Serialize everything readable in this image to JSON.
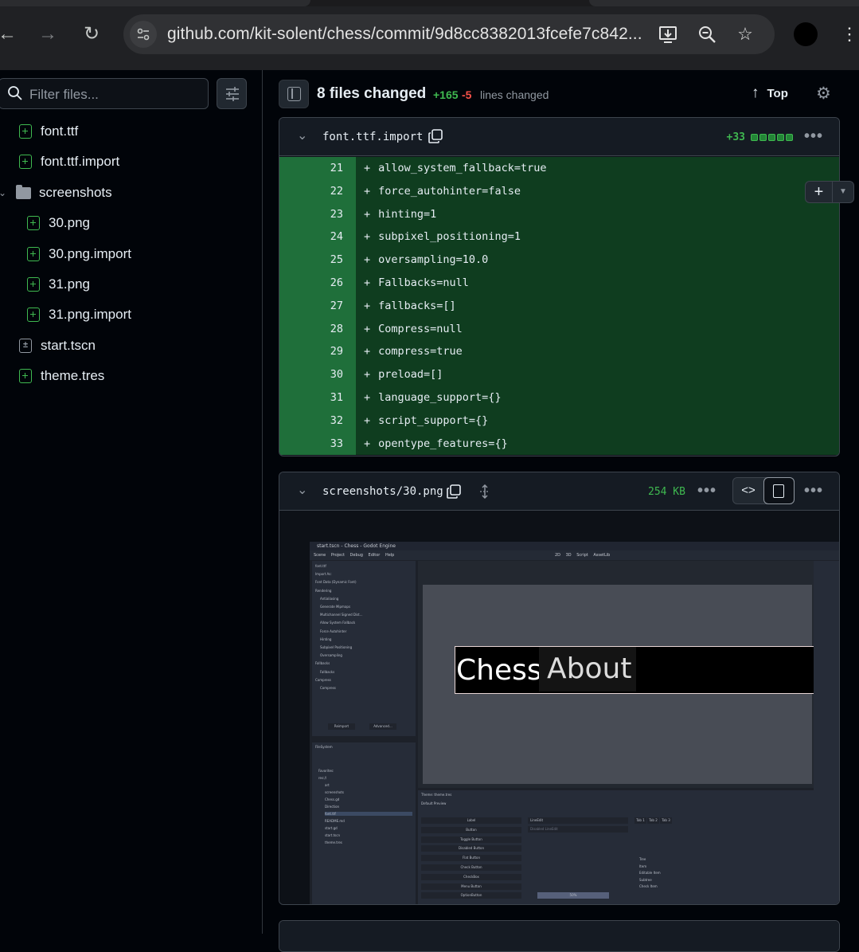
{
  "browser": {
    "url": "github.com/kit-solent/chess/commit/9d8cc8382013fcefe7c842...",
    "icons": [
      "back-arrow-icon",
      "forward-arrow-icon",
      "reload-icon",
      "site-info-icon",
      "install-app-icon",
      "zoom-icon",
      "bookmark-star-icon",
      "profile-avatar",
      "kebab-menu-icon"
    ]
  },
  "sidebar": {
    "filter_placeholder": "Filter files...",
    "files": [
      {
        "name": "font.ttf",
        "status": "added"
      },
      {
        "name": "font.ttf.import",
        "status": "added"
      },
      {
        "name": "screenshots",
        "type": "folder"
      },
      {
        "name": "30.png",
        "status": "added"
      },
      {
        "name": "30.png.import",
        "status": "added"
      },
      {
        "name": "31.png",
        "status": "added"
      },
      {
        "name": "31.png.import",
        "status": "added"
      },
      {
        "name": "start.tscn",
        "status": "modified"
      },
      {
        "name": "theme.tres",
        "status": "added"
      }
    ]
  },
  "header": {
    "files_changed": "8 files changed",
    "additions": "+165",
    "deletions": "-5",
    "lines_changed": "lines changed",
    "top_label": "Top"
  },
  "file1": {
    "name": "font.ttf.import",
    "diffstat": "+33",
    "lines": [
      {
        "num": "21",
        "sign": "+",
        "code": "allow_system_fallback=true"
      },
      {
        "num": "22",
        "sign": "+",
        "code": "force_autohinter=false"
      },
      {
        "num": "23",
        "sign": "+",
        "code": "hinting=1"
      },
      {
        "num": "24",
        "sign": "+",
        "code": "subpixel_positioning=1"
      },
      {
        "num": "25",
        "sign": "+",
        "code": "oversampling=10.0"
      },
      {
        "num": "26",
        "sign": "+",
        "code": "Fallbacks=null"
      },
      {
        "num": "27",
        "sign": "+",
        "code": "fallbacks=[]"
      },
      {
        "num": "28",
        "sign": "+",
        "code": "Compress=null"
      },
      {
        "num": "29",
        "sign": "+",
        "code": "compress=true"
      },
      {
        "num": "30",
        "sign": "+",
        "code": "preload=[]"
      },
      {
        "num": "31",
        "sign": "+",
        "code": "language_support={}"
      },
      {
        "num": "32",
        "sign": "+",
        "code": "script_support={}"
      },
      {
        "num": "33",
        "sign": "+",
        "code": "opentype_features={}"
      }
    ]
  },
  "file2": {
    "name": "screenshots/30.png",
    "size": "254 KB"
  },
  "godot_screenshot": {
    "title": "start.tscn - Chess - Godot Engine",
    "menu": "Scene Project Debug Editor Help",
    "workspaces": "2D 3D Script AssetLib",
    "chess_label": "Chess",
    "about_label": "About",
    "import_rows": [
      "font.ttf",
      "Import As:",
      "Font Data (Dynamic Font)",
      "Rendering",
      "Antialiasing",
      "Generate Mipmaps",
      "Multichannel Signed Dist...",
      "Allow System Fallback",
      "Force Autohinter",
      "Hinting",
      "Subpixel Positioning",
      "Oversampling",
      "Fallbacks",
      "Fallbacks",
      "Compress",
      "Compress"
    ],
    "reimport": "Reimport",
    "advanced": "Advanced...",
    "filesystem": "FileSystem",
    "fs_items": [
      "Favorites:",
      "res://",
      "art",
      "screenshots",
      "Chess.gd",
      "Direction",
      "font.ttf",
      "README.md",
      "start.gd",
      "start.tscn",
      "theme.tres"
    ],
    "theme_title": "Theme: theme.tres",
    "default_preview": "Default Preview",
    "preview_items": [
      "Label",
      "Button",
      "Toggle Button",
      "Disabled Button",
      "Flat Button",
      "Check Button",
      "CheckBox",
      "Menu Button",
      "OptionButton"
    ],
    "line_edit": "LineEdit",
    "disabled_line_edit": "Disabled LineEdit",
    "tabs": [
      "Tab 1",
      "Tab 2",
      "Tab 3"
    ],
    "tree_items": [
      "Tree",
      "Item",
      "Editable Item",
      "Subtree",
      "Check Item"
    ],
    "percent": "50%"
  }
}
